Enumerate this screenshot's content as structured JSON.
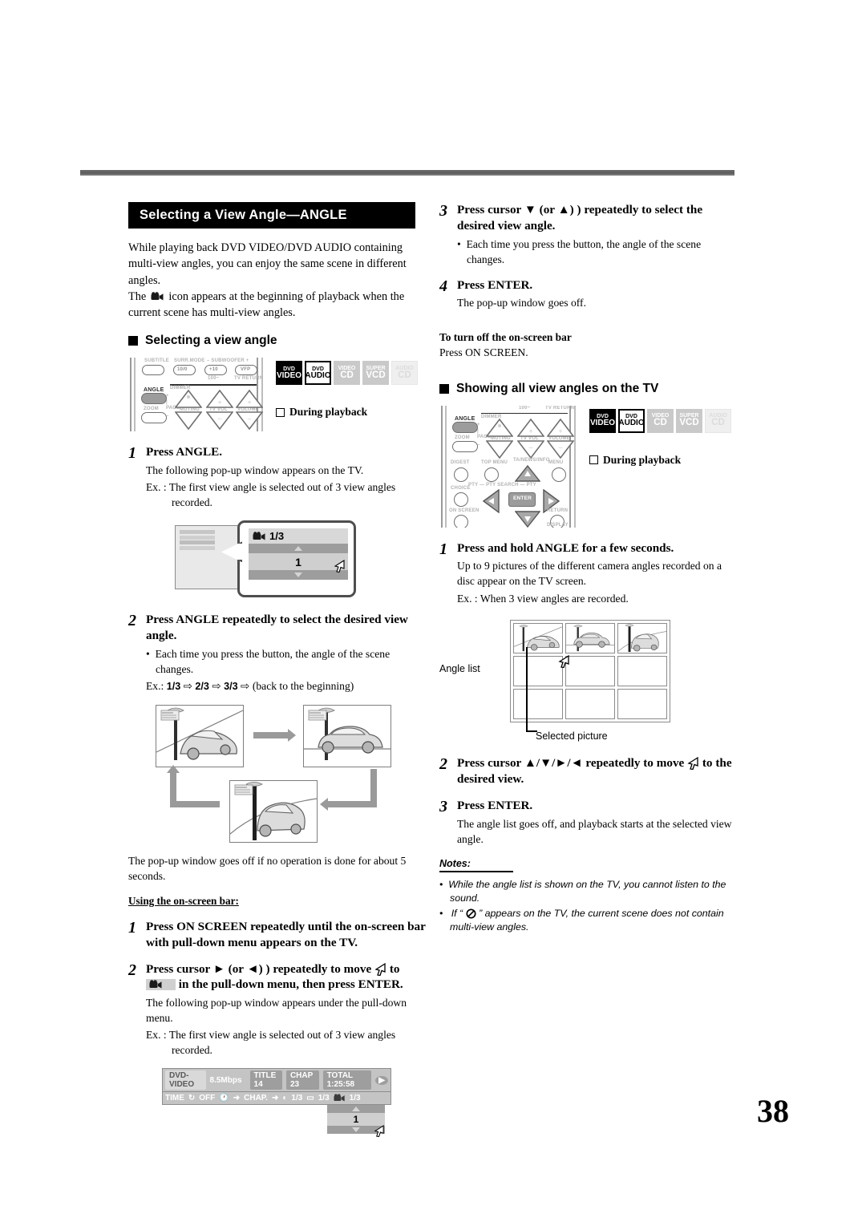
{
  "page": {
    "number": "38"
  },
  "section": {
    "title": "Selecting a View Angle—ANGLE"
  },
  "intro": {
    "line1": "While playing back DVD VIDEO/DVD AUDIO containing multi-view angles, you can enjoy the same scene in different angles.",
    "line2_pre": "The",
    "line2_post": "icon appears at the beginning of playback when the current scene has multi-view angles."
  },
  "subheads": {
    "selecting": "Selecting a view angle",
    "showing": "Showing all view angles on the TV"
  },
  "remote1": {
    "labels": {
      "subtitle": "SUBTITLE",
      "surrmode": "SURR.MODE",
      "subwoofer": "– SUBWOOFER +",
      "tenzero": "10/0",
      "plusten": "+10",
      "vfp": "VFP",
      "hundred": "100~",
      "tvreturn": "TV RETURN",
      "angle": "ANGLE",
      "zoom": "ZOOM",
      "dimmer": "DIMMER",
      "page": "PAGE",
      "muting": "MUTING",
      "tvvol": "TV VOL",
      "volume": "VOLUME"
    }
  },
  "remote2": {
    "labels": {
      "angle": "ANGLE",
      "zoom": "ZOOM",
      "dimmer": "DIMMER",
      "page": "PAGE",
      "muting": "MUTING",
      "tvvol": "TV VOL",
      "volume": "VOLUME",
      "digest": "DIGEST",
      "topmenu": "TOP MENU",
      "tanewsinfo": "TA/NEWS/INFO",
      "menu": "MENU",
      "choice": "CHOICE",
      "enter": "ENTER",
      "ptysearch": "PTY — PTY SEARCH — PTY",
      "onscreen": "ON SCREEN",
      "return": "RETURN",
      "display": "DISPLAY",
      "hundred": "100~",
      "tvreturn": "TV RETURN"
    }
  },
  "badges": [
    {
      "top": "DVD",
      "bottom": "VIDEO",
      "state": "active-black"
    },
    {
      "top": "DVD",
      "bottom": "AUDIO",
      "state": "active-white"
    },
    {
      "top": "VIDEO",
      "bottom": "CD",
      "state": "inactive-mid"
    },
    {
      "top": "SUPER",
      "bottom": "VCD",
      "state": "inactive-mid"
    },
    {
      "top": "AUDIO",
      "bottom": "CD",
      "state": "inactive-light"
    }
  ],
  "during_playback": "During playback",
  "left": {
    "step1": {
      "num": "1",
      "title": "Press ANGLE.",
      "sub": "The following pop-up window appears on the TV.",
      "ex": "Ex. :  The first view angle is selected out of 3 view angles recorded."
    },
    "popup": {
      "count": "1/3",
      "value": "1"
    },
    "step2": {
      "num": "2",
      "title": "Press ANGLE repeatedly to select the desired view angle.",
      "bullet": "Each time you press the button, the angle of the scene changes.",
      "ex_pre": "Ex.:",
      "seq1": "1/3",
      "seq2": "2/3",
      "seq3": "3/3",
      "ex_post": "(back to the beginning)"
    },
    "after_cars": "The pop-up window goes off if no operation is done for about 5 seconds.",
    "onscreen_head": "Using the on-screen bar:",
    "os_step1": {
      "num": "1",
      "title": "Press ON SCREEN repeatedly until the on-screen bar with pull-down menu appears on the TV."
    },
    "os_step2": {
      "num": "2",
      "title_a": "Press cursor",
      "title_b": "(or",
      "title_c": ") repeatedly to move",
      "title_d": "to",
      "title_e": "in the pull-down menu, then press ENTER.",
      "sub": "The following pop-up window appears under the pull-down menu.",
      "ex": "Ex. :  The first view angle is selected out of 3 view angles recorded."
    },
    "onscreen_bar": {
      "disc": "DVD-VIDEO",
      "bitrate": "8.5Mbps",
      "title_chip": "TITLE 14",
      "chap_chip": "CHAP 23",
      "total_chip": "TOTAL 1:25:58",
      "time": "TIME",
      "repeat": "OFF",
      "chap": "CHAP.",
      "audio_val": "1/3",
      "subtitle_val": "1/3",
      "angle_val": "1/3",
      "drop_value": "1"
    }
  },
  "right": {
    "step3": {
      "num": "3",
      "title_a": "Press cursor",
      "title_b": "(or",
      "title_c": ") repeatedly to select the desired view angle.",
      "bullet": "Each time you press the button, the angle of the scene changes."
    },
    "step4": {
      "num": "4",
      "title": "Press ENTER.",
      "sub": "The pop-up window goes off."
    },
    "turn_off": {
      "head": "To turn off the on-screen bar",
      "body": "Press ON SCREEN."
    },
    "step1": {
      "num": "1",
      "title": "Press and hold ANGLE for a few seconds.",
      "sub": "Up to 9 pictures of the different camera angles recorded on a disc appear on the TV screen.",
      "ex": "Ex. : When 3 view angles are recorded."
    },
    "grid": {
      "label_list": "Angle list",
      "label_selected": "Selected picture",
      "rows": 3,
      "cols": 3,
      "filled": 3
    },
    "step2": {
      "num": "2",
      "title_a": "Press cursor",
      "title_b": "repeatedly to move",
      "title_c": "to the desired view.",
      "cursors": "▲/▼/►/◄"
    },
    "step3b": {
      "num": "3",
      "title": "Press ENTER.",
      "sub": "The angle list goes off, and playback starts at the selected view angle."
    },
    "notes_head": "Notes:",
    "notes": [
      "While the angle list is shown on the TV, you cannot listen to the sound.",
      "If “        ” appears on the TV, the current scene does not contain multi-view angles."
    ],
    "note2_pre": "If “",
    "note2_post": "” appears on the TV, the current scene does not contain multi-view angles."
  }
}
